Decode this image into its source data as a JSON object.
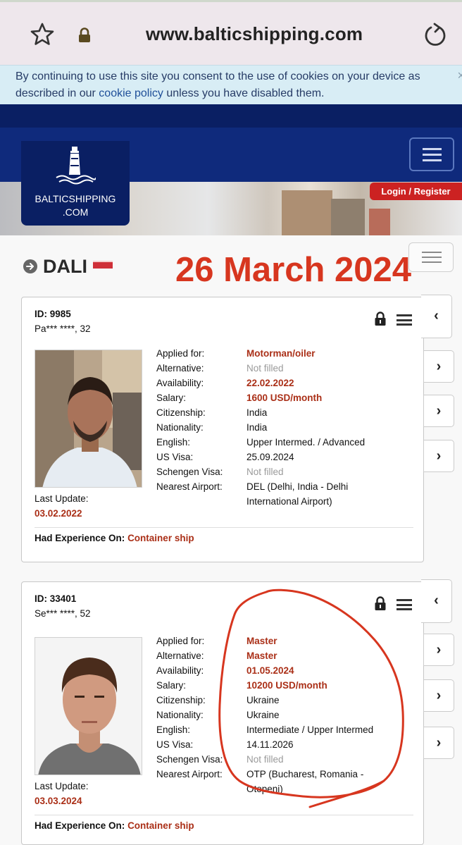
{
  "browser": {
    "url": "www.balticshipping.com"
  },
  "cookie_banner": {
    "text_before_link": "By continuing to use this site you consent to the use of cookies on your device as described in our ",
    "link_text": "cookie policy",
    "text_after_link": " unless you have disabled them.",
    "close": "×"
  },
  "site": {
    "logo_line1": "BALTICSHIPPING",
    "logo_line2": ".COM",
    "login": "Login",
    "separator": " / ",
    "register": "Register"
  },
  "vessel": {
    "name": "DALI",
    "overlay_date": "26 March 2024"
  },
  "field_labels": {
    "applied_for": "Applied for:",
    "alternative": "Alternative:",
    "availability": "Availability:",
    "salary": "Salary:",
    "citizenship": "Citizenship:",
    "nationality": "Nationality:",
    "english": "English:",
    "us_visa": "US Visa:",
    "schengen_visa": "Schengen Visa:",
    "nearest_airport": "Nearest Airport:",
    "last_update": "Last Update:",
    "had_experience": "Had Experience On:"
  },
  "cards": [
    {
      "id": "ID: 9985",
      "name": "Pa*** ****, 32",
      "applied_for": "Motorman/oiler",
      "alternative": "Not filled",
      "availability": "22.02.2022",
      "salary": "1600 USD/month",
      "citizenship": "India",
      "nationality": "India",
      "english": "Upper Intermed. / Advanced",
      "us_visa": "25.09.2024",
      "schengen_visa": "Not filled",
      "airport_line1": "DEL (Delhi, India - Delhi",
      "airport_line2": "International Airport)",
      "last_update": "03.02.2022",
      "experience": "Container ship"
    },
    {
      "id": "ID: 33401",
      "name": "Se*** ****, 52",
      "applied_for": "Master",
      "alternative": "Master",
      "availability": "01.05.2024",
      "salary": "10200 USD/month",
      "citizenship": "Ukraine",
      "nationality": "Ukraine",
      "english": "Intermediate / Upper Intermed",
      "us_visa": "14.11.2026",
      "schengen_visa": "Not filled",
      "airport_line1": "OTP (Bucharest, Romania -",
      "airport_line2": "Otopeni)",
      "last_update": "03.03.2024",
      "experience": "Container ship"
    }
  ],
  "nav_glyphs": {
    "collapse": "‹",
    "next": "›"
  },
  "colors": {
    "navy": "#0a1f63",
    "annotation_red": "#d7361f",
    "value_red": "#aa2f17",
    "cookie_bg": "#d8edf5"
  }
}
